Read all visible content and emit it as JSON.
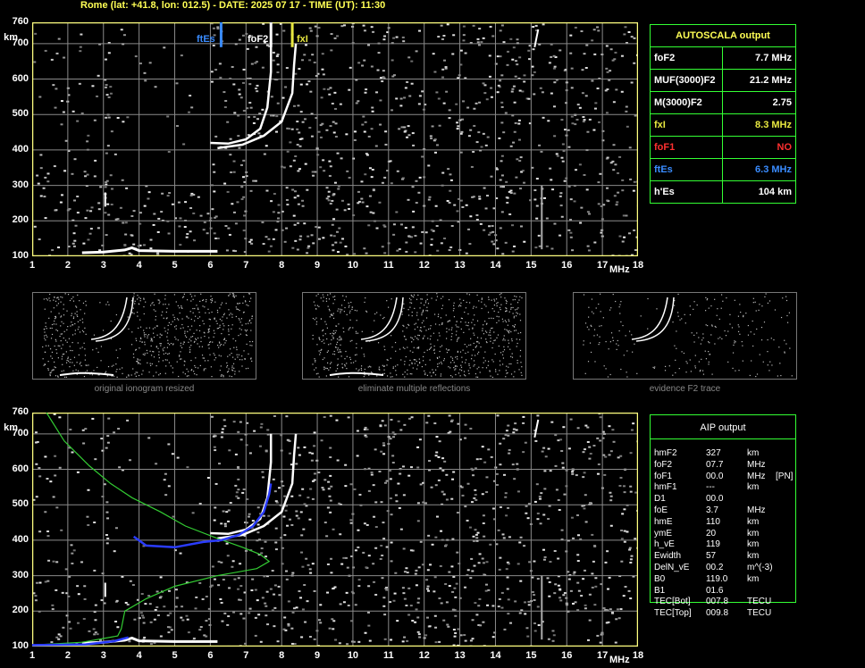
{
  "header": {
    "title": "Rome (lat: +41.8, lon: 012.5) - DATE: 2025 07 17 - TIME (UT): 11:30"
  },
  "axes": {
    "ylabel": "km",
    "xunit": "MHz",
    "yticks": [
      "760",
      "700",
      "600",
      "500",
      "400",
      "300",
      "200",
      "100"
    ],
    "xticks": [
      "1",
      "2",
      "3",
      "4",
      "5",
      "6",
      "7",
      "8",
      "9",
      "10",
      "11",
      "12",
      "13",
      "14",
      "15",
      "16",
      "17",
      "18"
    ]
  },
  "markers": {
    "ftEs_label": "ftEs",
    "foF2_label": "foF2",
    "fxI_label": "fxI"
  },
  "autoscala": {
    "title": "AUTOSCALA output",
    "rows": [
      {
        "label": "foF2",
        "value": "7.7 MHz",
        "color": "#ffffff"
      },
      {
        "label": "MUF(3000)F2",
        "value": "21.2 MHz",
        "color": "#ffffff"
      },
      {
        "label": "M(3000)F2",
        "value": "2.75",
        "color": "#ffffff"
      },
      {
        "label": "fxI",
        "value": "8.3 MHz",
        "color": "#e8e840"
      },
      {
        "label": "foF1",
        "value": "NO",
        "color": "#ff3030"
      },
      {
        "label": "ftEs",
        "value": "6.3 MHz",
        "color": "#3a8cff"
      },
      {
        "label": "h'Es",
        "value": "104    km",
        "color": "#ffffff"
      }
    ]
  },
  "thumbnails": [
    {
      "caption": "original ionogram resized"
    },
    {
      "caption": "eliminate multiple reflections"
    },
    {
      "caption": "evidence F2 trace"
    }
  ],
  "aip": {
    "title": "AIP output",
    "rows": [
      {
        "k": "hmF2",
        "v": "327",
        "u": "km",
        "x": ""
      },
      {
        "k": "foF2",
        "v": "07.7",
        "u": "MHz",
        "x": ""
      },
      {
        "k": "foF1",
        "v": "00.0",
        "u": "MHz",
        "x": "[PN]"
      },
      {
        "k": "hmF1",
        "v": "---",
        "u": "km",
        "x": ""
      },
      {
        "k": "D1",
        "v": "00.0",
        "u": "",
        "x": ""
      },
      {
        "k": "foE",
        "v": "3.7",
        "u": "MHz",
        "x": ""
      },
      {
        "k": "hmE",
        "v": "110",
        "u": "km",
        "x": ""
      },
      {
        "k": "ymE",
        "v": "20",
        "u": "km",
        "x": ""
      },
      {
        "k": "h_vE",
        "v": "119",
        "u": "km",
        "x": ""
      },
      {
        "k": "Ewidth",
        "v": "57",
        "u": "km",
        "x": ""
      },
      {
        "k": "DelN_vE",
        "v": "00.2",
        "u": "m^(-3)",
        "x": ""
      },
      {
        "k": "B0",
        "v": "119.0",
        "u": "km",
        "x": ""
      },
      {
        "k": "B1",
        "v": "01.6",
        "u": "",
        "x": ""
      },
      {
        "k": "TEC[Bot]",
        "v": "007.8",
        "u": "TECU",
        "x": ""
      },
      {
        "k": "TEC[Top]",
        "v": "009.8",
        "u": "TECU",
        "x": ""
      }
    ]
  },
  "colors": {
    "grid": "#8a8a8a",
    "frame": "#ffff80",
    "trace": "#ffffff",
    "profile": "#33cc33",
    "fit": "#2a3cff",
    "ftEs": "#3a8cff",
    "fxI": "#e8e840",
    "box_border": "#33ff33"
  }
}
